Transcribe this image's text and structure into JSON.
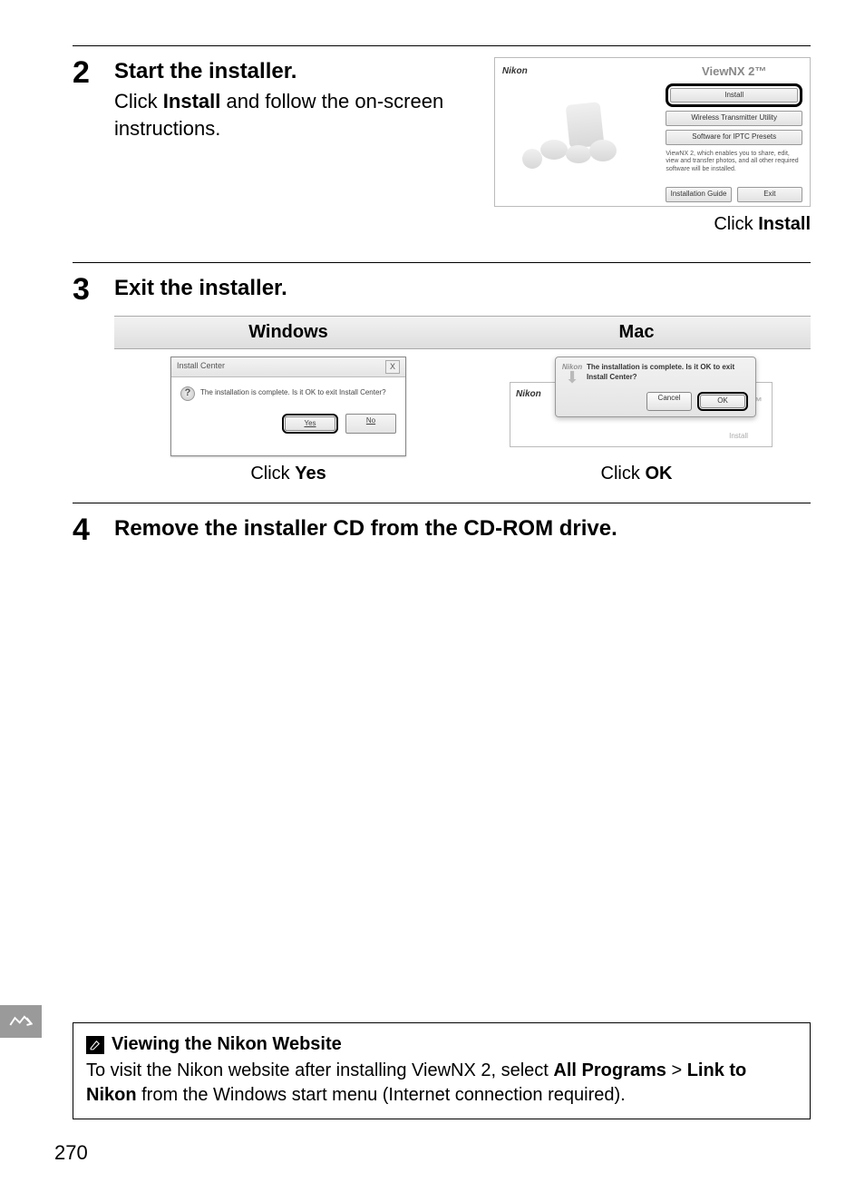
{
  "steps": {
    "s2": {
      "num": "2",
      "title": "Start the installer.",
      "text_prefix": "Click ",
      "text_bold": "Install",
      "text_suffix": " and follow the on-screen instructions."
    },
    "s3": {
      "num": "3",
      "title": "Exit the installer."
    },
    "s4": {
      "num": "4",
      "title": "Remove the installer CD from the CD-ROM drive."
    }
  },
  "installer": {
    "logo": "Nikon",
    "title": "ViewNX 2™",
    "btn_install": "Install",
    "btn_wireless": "Wireless Transmitter Utility",
    "btn_iptc": "Software for IPTC Presets",
    "desc": "ViewNX 2, which enables you to share, edit, view and transfer photos, and all other required software will be installed.",
    "btn_guide": "Installation Guide",
    "btn_exit": "Exit",
    "caption_prefix": "Click ",
    "caption_bold": "Install"
  },
  "exit": {
    "win_header": "Windows",
    "mac_header": "Mac",
    "win": {
      "titlebar": "Install Center",
      "close": "X",
      "question_mark": "?",
      "msg": "The installation is complete. Is it OK to exit Install Center?",
      "yes": "Yes",
      "no": "No",
      "caption_prefix": "Click ",
      "caption_bold": "Yes"
    },
    "mac": {
      "logo_small": "Nikon",
      "msg": "The installation is complete. Is it OK to exit Install Center?",
      "cancel": "Cancel",
      "ok": "OK",
      "logo": "Nikon",
      "bg_title": "NX 2™",
      "bg_install": "Install",
      "caption_prefix": "Click ",
      "caption_bold": "OK"
    }
  },
  "tip": {
    "title": "Viewing the Nikon Website",
    "p1a": "To visit the Nikon website after installing ViewNX 2, select ",
    "p1b": "All Programs",
    "p1c": " > ",
    "p1d": "Link to Nikon",
    "p1e": " from the Windows start menu (Internet connection required)."
  },
  "page_number": "270"
}
